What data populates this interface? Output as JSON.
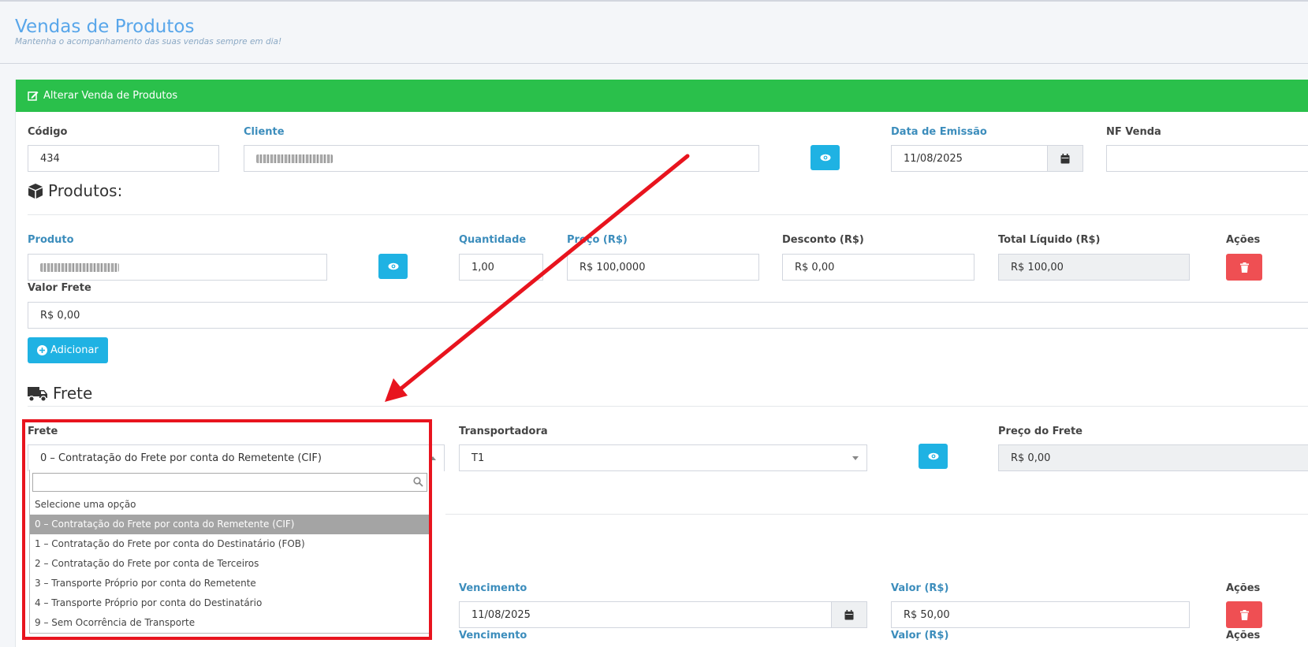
{
  "page": {
    "title": "Vendas de Produtos",
    "subtitle": "Mantenha o acompanhamento das suas vendas sempre em dia!"
  },
  "card": {
    "header": "Alterar Venda de Produtos"
  },
  "sale": {
    "codigo_label": "Código",
    "codigo_value": "434",
    "cliente_label": "Cliente",
    "data_label": "Data de Emissão",
    "data_value": "11/08/2025",
    "nf_label": "NF Venda",
    "nf_value": ""
  },
  "produtos": {
    "title": "Produtos:",
    "produto_label": "Produto",
    "quantidade_label": "Quantidade",
    "quantidade_value": "1,00",
    "preco_label": "Preço (R$)",
    "preco_value": "R$ 100,0000",
    "desconto_label": "Desconto (R$)",
    "desconto_value": "R$ 0,00",
    "total_label": "Total Líquido (R$)",
    "total_value": "R$ 100,00",
    "acoes_label": "Ações",
    "valor_frete_label": "Valor Frete",
    "valor_frete_value": "R$ 0,00",
    "add_button": "Adicionar"
  },
  "frete": {
    "title": "Frete",
    "frete_label": "Frete",
    "frete_selected": "0 – Contratação do Frete por conta do Remetente (CIF)",
    "transportadora_label": "Transportadora",
    "transportadora_value": "T1",
    "preco_frete_label": "Preço do Frete",
    "preco_frete_value": "R$ 0,00",
    "search_value": "",
    "options": [
      "Selecione uma opção",
      "0 – Contratação do Frete por conta do Remetente (CIF)",
      "1 – Contratação do Frete por conta do Destinatário (FOB)",
      "2 – Contratação do Frete por conta de Terceiros",
      "3 – Transporte Próprio por conta do Remetente",
      "4 – Transporte Próprio por conta do Destinatário",
      "9 – Sem Ocorrência de Transporte"
    ]
  },
  "parcelas": {
    "vencimento_label": "Vencimento",
    "vencimento_value": "11/08/2025",
    "valor_label": "Valor (R$)",
    "valor_value": "R$ 50,00",
    "acoes_label": "Ações"
  },
  "colors": {
    "accent_green": "#2ac04b",
    "info": "#1fb2e3",
    "danger": "#ef4f53",
    "highlight": "#e8141e",
    "title_blue": "#58a6ea"
  }
}
